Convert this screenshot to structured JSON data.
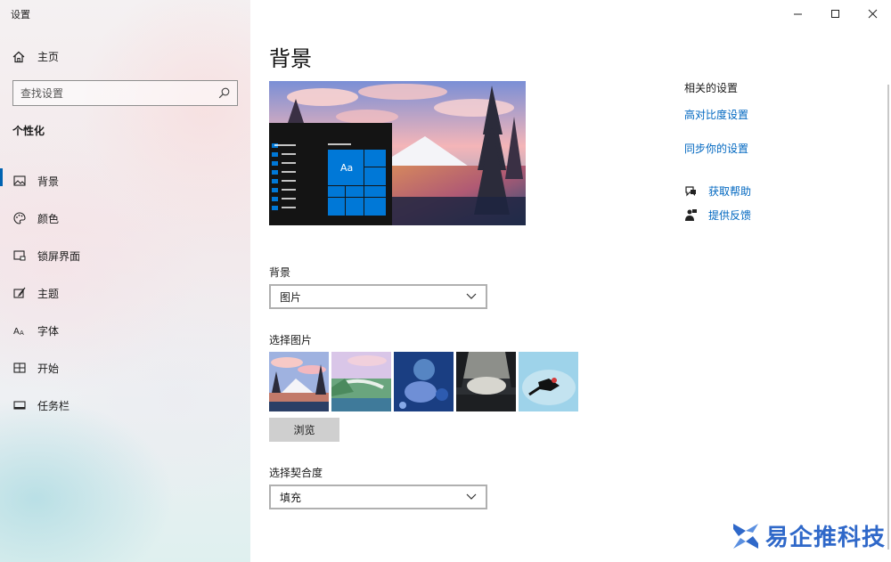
{
  "window": {
    "title": "设置"
  },
  "sidebar": {
    "home_label": "主页",
    "search_placeholder": "查找设置",
    "section_title": "个性化",
    "items": [
      {
        "label": "背景",
        "icon": "picture-icon",
        "active": true
      },
      {
        "label": "颜色",
        "icon": "palette-icon",
        "active": false
      },
      {
        "label": "锁屏界面",
        "icon": "lock-screen-icon",
        "active": false
      },
      {
        "label": "主题",
        "icon": "theme-brush-icon",
        "active": false
      },
      {
        "label": "字体",
        "icon": "font-icon",
        "active": false
      },
      {
        "label": "开始",
        "icon": "start-grid-icon",
        "active": false
      },
      {
        "label": "任务栏",
        "icon": "taskbar-icon",
        "active": false
      }
    ]
  },
  "main": {
    "title": "背景",
    "preview_sample_text": "Aa",
    "background_label": "背景",
    "background_value": "图片",
    "choose_picture_label": "选择图片",
    "browse_label": "浏览",
    "fit_label": "选择契合度",
    "fit_value": "填充"
  },
  "related": {
    "title": "相关的设置",
    "links": [
      "高对比度设置",
      "同步你的设置"
    ],
    "help_label": "获取帮助",
    "feedback_label": "提供反馈"
  },
  "watermark": {
    "text": "易企推科技"
  },
  "colors": {
    "accent": "#0063b1",
    "link": "#0067c0",
    "tile": "#0078d7"
  }
}
